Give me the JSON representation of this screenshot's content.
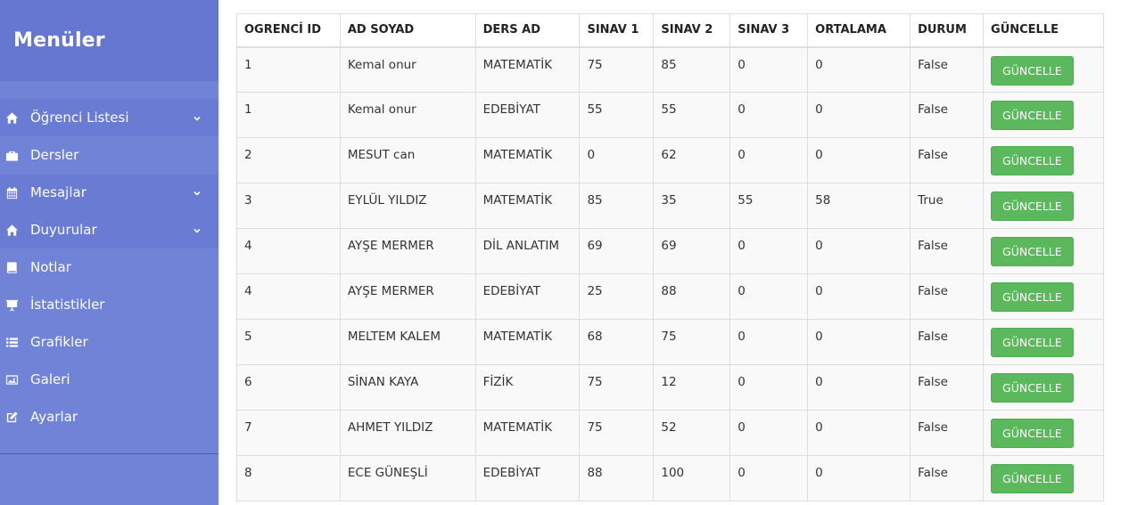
{
  "sidebar": {
    "title": "Menüler",
    "items": [
      {
        "label": "Öğrenci Listesi",
        "icon": "home-icon",
        "dark": true,
        "chevron": true
      },
      {
        "label": "Dersler",
        "icon": "briefcase-icon",
        "dark": false,
        "chevron": false
      },
      {
        "label": "Mesajlar",
        "icon": "calendar-icon",
        "dark": true,
        "chevron": true
      },
      {
        "label": "Duyurular",
        "icon": "home-icon",
        "dark": true,
        "chevron": true
      },
      {
        "label": "Notlar",
        "icon": "book-icon",
        "dark": false,
        "chevron": false
      },
      {
        "label": "İstatistikler",
        "icon": "presentation-icon",
        "dark": false,
        "chevron": false
      },
      {
        "label": "Grafikler",
        "icon": "list-icon",
        "dark": false,
        "chevron": false
      },
      {
        "label": "Galeri",
        "icon": "image-icon",
        "dark": false,
        "chevron": false
      },
      {
        "label": "Ayarlar",
        "icon": "edit-icon",
        "dark": false,
        "chevron": false
      }
    ]
  },
  "table": {
    "headers": [
      "OGRENCİ ID",
      "AD SOYAD",
      "DERS AD",
      "SINAV 1",
      "SINAV 2",
      "SINAV 3",
      "ORTALAMA",
      "DURUM",
      "GÜNCELLE"
    ],
    "button_label": "GÜNCELLE",
    "rows": [
      [
        "1",
        "Kemal onur",
        "MATEMATİK",
        "75",
        "85",
        "0",
        "0",
        "False"
      ],
      [
        "1",
        "Kemal onur",
        "EDEBİYAT",
        "55",
        "55",
        "0",
        "0",
        "False"
      ],
      [
        "2",
        "MESUT can",
        "MATEMATİK",
        "0",
        "62",
        "0",
        "0",
        "False"
      ],
      [
        "3",
        "EYLÜL YILDIZ",
        "MATEMATİK",
        "85",
        "35",
        "55",
        "58",
        "True"
      ],
      [
        "4",
        "AYŞE MERMER",
        "DİL ANLATIM",
        "69",
        "69",
        "0",
        "0",
        "False"
      ],
      [
        "4",
        "AYŞE MERMER",
        "EDEBİYAT",
        "25",
        "88",
        "0",
        "0",
        "False"
      ],
      [
        "5",
        "MELTEM KALEM",
        "MATEMATİK",
        "68",
        "75",
        "0",
        "0",
        "False"
      ],
      [
        "6",
        "SİNAN KAYA",
        "FİZİK",
        "75",
        "12",
        "0",
        "0",
        "False"
      ],
      [
        "7",
        "AHMET YILDIZ",
        "MATEMATİK",
        "75",
        "52",
        "0",
        "0",
        "False"
      ],
      [
        "8",
        "ECE GÜNEŞLİ",
        "EDEBİYAT",
        "88",
        "100",
        "0",
        "0",
        "False"
      ]
    ]
  },
  "colors": {
    "sidebar_bg": "#7083d6",
    "sidebar_header_bg": "#6677d1",
    "button_green": "#5cb85c"
  }
}
